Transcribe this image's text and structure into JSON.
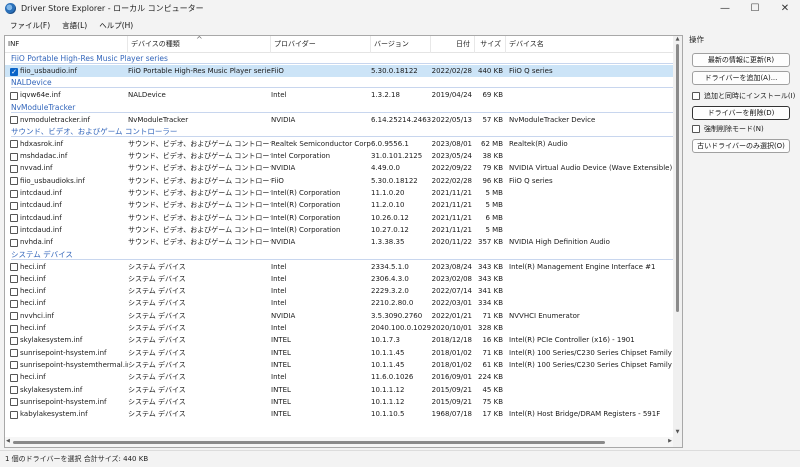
{
  "window": {
    "title": "Driver Store Explorer - ローカル コンピューター",
    "minimize": "—",
    "maximize": "☐",
    "close": "✕"
  },
  "menu": [
    "ファイル(F)",
    "言語(L)",
    "ヘルプ(H)"
  ],
  "columns": {
    "inf": "INF",
    "class": "デバイスの種類",
    "sort_arrow": "^",
    "provider": "プロバイダー",
    "version": "バージョン",
    "date": "日付",
    "size": "サイズ",
    "device": "デバイス名"
  },
  "groups": [
    {
      "name": "FiiO Portable High-Res Music Player series",
      "rows": [
        {
          "checked": true,
          "selected": true,
          "inf": "fiio_usbaudio.inf",
          "class": "FiiO Portable High-Res Music Player series",
          "provider": "FiiO",
          "version": "5.30.0.18122",
          "date": "2022/02/28",
          "size": "440 KB",
          "device": "FiiO Q series"
        }
      ]
    },
    {
      "name": "NALDevice",
      "rows": [
        {
          "checked": false,
          "selected": false,
          "inf": "iqvw64e.inf",
          "class": "NALDevice",
          "provider": "Intel",
          "version": "1.3.2.18",
          "date": "2019/04/24",
          "size": "69 KB",
          "device": ""
        }
      ]
    },
    {
      "name": "NvModuleTracker",
      "rows": [
        {
          "checked": false,
          "selected": false,
          "inf": "nvmoduletracker.inf",
          "class": "NvModuleTracker",
          "provider": "NVIDIA",
          "version": "6.14.25214.24630",
          "date": "2022/05/13",
          "size": "57 KB",
          "device": "NvModuleTracker Device"
        }
      ]
    },
    {
      "name": "サウンド、ビデオ、およびゲーム コントローラー",
      "rows": [
        {
          "checked": false,
          "selected": false,
          "inf": "hdxasrok.inf",
          "class": "サウンド、ビデオ、およびゲーム コントローラー",
          "provider": "Realtek Semiconductor Corp.",
          "version": "6.0.9556.1",
          "date": "2023/08/01",
          "size": "62 MB",
          "device": "Realtek(R) Audio"
        },
        {
          "checked": false,
          "selected": false,
          "inf": "mshdadac.inf",
          "class": "サウンド、ビデオ、およびゲーム コントローラー",
          "provider": "Intel Corporation",
          "version": "31.0.101.2125",
          "date": "2023/05/24",
          "size": "38 KB",
          "device": ""
        },
        {
          "checked": false,
          "selected": false,
          "inf": "nvvad.inf",
          "class": "サウンド、ビデオ、およびゲーム コントローラー",
          "provider": "NVIDIA",
          "version": "4.49.0.0",
          "date": "2022/09/22",
          "size": "79 KB",
          "device": "NVIDIA Virtual Audio Device (Wave Extensible) (WDM)"
        },
        {
          "checked": false,
          "selected": false,
          "inf": "fiio_usbaudioks.inf",
          "class": "サウンド、ビデオ、およびゲーム コントローラー",
          "provider": "FiiO",
          "version": "5.30.0.18122",
          "date": "2022/02/28",
          "size": "96 KB",
          "device": "FiiO Q series"
        },
        {
          "checked": false,
          "selected": false,
          "inf": "intcdaud.inf",
          "class": "サウンド、ビデオ、およびゲーム コントローラー",
          "provider": "Intel(R) Corporation",
          "version": "11.1.0.20",
          "date": "2021/11/21",
          "size": "5 MB",
          "device": ""
        },
        {
          "checked": false,
          "selected": false,
          "inf": "intcdaud.inf",
          "class": "サウンド、ビデオ、およびゲーム コントローラー",
          "provider": "Intel(R) Corporation",
          "version": "11.2.0.10",
          "date": "2021/11/21",
          "size": "5 MB",
          "device": ""
        },
        {
          "checked": false,
          "selected": false,
          "inf": "intcdaud.inf",
          "class": "サウンド、ビデオ、およびゲーム コントローラー",
          "provider": "Intel(R) Corporation",
          "version": "10.26.0.12",
          "date": "2021/11/21",
          "size": "6 MB",
          "device": ""
        },
        {
          "checked": false,
          "selected": false,
          "inf": "intcdaud.inf",
          "class": "サウンド、ビデオ、およびゲーム コントローラー",
          "provider": "Intel(R) Corporation",
          "version": "10.27.0.12",
          "date": "2021/11/21",
          "size": "5 MB",
          "device": ""
        },
        {
          "checked": false,
          "selected": false,
          "inf": "nvhda.inf",
          "class": "サウンド、ビデオ、およびゲーム コントローラー",
          "provider": "NVIDIA",
          "version": "1.3.38.35",
          "date": "2020/11/22",
          "size": "357 KB",
          "device": "NVIDIA High Definition Audio"
        }
      ]
    },
    {
      "name": "システム デバイス",
      "rows": [
        {
          "checked": false,
          "selected": false,
          "inf": "heci.inf",
          "class": "システム デバイス",
          "provider": "Intel",
          "version": "2334.5.1.0",
          "date": "2023/08/24",
          "size": "343 KB",
          "device": "Intel(R) Management Engine Interface #1"
        },
        {
          "checked": false,
          "selected": false,
          "inf": "heci.inf",
          "class": "システム デバイス",
          "provider": "Intel",
          "version": "2306.4.3.0",
          "date": "2023/02/08",
          "size": "343 KB",
          "device": ""
        },
        {
          "checked": false,
          "selected": false,
          "inf": "heci.inf",
          "class": "システム デバイス",
          "provider": "Intel",
          "version": "2229.3.2.0",
          "date": "2022/07/14",
          "size": "341 KB",
          "device": ""
        },
        {
          "checked": false,
          "selected": false,
          "inf": "heci.inf",
          "class": "システム デバイス",
          "provider": "Intel",
          "version": "2210.2.80.0",
          "date": "2022/03/01",
          "size": "334 KB",
          "device": ""
        },
        {
          "checked": false,
          "selected": false,
          "inf": "nvvhci.inf",
          "class": "システム デバイス",
          "provider": "NVIDIA",
          "version": "3.5.3090.2760",
          "date": "2022/01/21",
          "size": "71 KB",
          "device": "NVVHCI Enumerator"
        },
        {
          "checked": false,
          "selected": false,
          "inf": "heci.inf",
          "class": "システム デバイス",
          "provider": "Intel",
          "version": "2040.100.0.1029",
          "date": "2020/10/01",
          "size": "328 KB",
          "device": ""
        },
        {
          "checked": false,
          "selected": false,
          "inf": "skylakesystem.inf",
          "class": "システム デバイス",
          "provider": "INTEL",
          "version": "10.1.7.3",
          "date": "2018/12/18",
          "size": "16 KB",
          "device": "Intel(R) PCIe Controller (x16) - 1901"
        },
        {
          "checked": false,
          "selected": false,
          "inf": "sunrisepoint-hsystem.inf",
          "class": "システム デバイス",
          "provider": "INTEL",
          "version": "10.1.1.45",
          "date": "2018/01/02",
          "size": "71 KB",
          "device": "Intel(R) 100 Series/C230 Series Chipset Family PMC - A121"
        },
        {
          "checked": false,
          "selected": false,
          "inf": "sunrisepoint-hsystemthermal.inf",
          "class": "システム デバイス",
          "provider": "INTEL",
          "version": "10.1.1.45",
          "date": "2018/01/02",
          "size": "61 KB",
          "device": "Intel(R) 100 Series/C230 Series Chipset Family Thermal"
        },
        {
          "checked": false,
          "selected": false,
          "inf": "heci.inf",
          "class": "システム デバイス",
          "provider": "Intel",
          "version": "11.6.0.1026",
          "date": "2016/09/01",
          "size": "224 KB",
          "device": ""
        },
        {
          "checked": false,
          "selected": false,
          "inf": "skylakesystem.inf",
          "class": "システム デバイス",
          "provider": "INTEL",
          "version": "10.1.1.12",
          "date": "2015/09/21",
          "size": "45 KB",
          "device": ""
        },
        {
          "checked": false,
          "selected": false,
          "inf": "sunrisepoint-hsystem.inf",
          "class": "システム デバイス",
          "provider": "INTEL",
          "version": "10.1.1.12",
          "date": "2015/09/21",
          "size": "75 KB",
          "device": ""
        },
        {
          "checked": false,
          "selected": false,
          "inf": "kabylakesystem.inf",
          "class": "システム デバイス",
          "provider": "INTEL",
          "version": "10.1.10.5",
          "date": "1968/07/18",
          "size": "17 KB",
          "device": "Intel(R) Host Bridge/DRAM Registers - 591F"
        }
      ]
    }
  ],
  "ops": {
    "title": "操作",
    "refresh": "最新の情報に更新(R)",
    "add_driver": "ドライバーを追加(A)...",
    "install_with_add": "追加と同時にインストール(I)",
    "delete_driver": "ドライバーを削除(D)",
    "force_delete": "強制削除モード(N)",
    "select_old": "古いドライバーのみ選択(O)"
  },
  "status": "1 個のドライバーを選択 合計サイズ: 440 KB"
}
